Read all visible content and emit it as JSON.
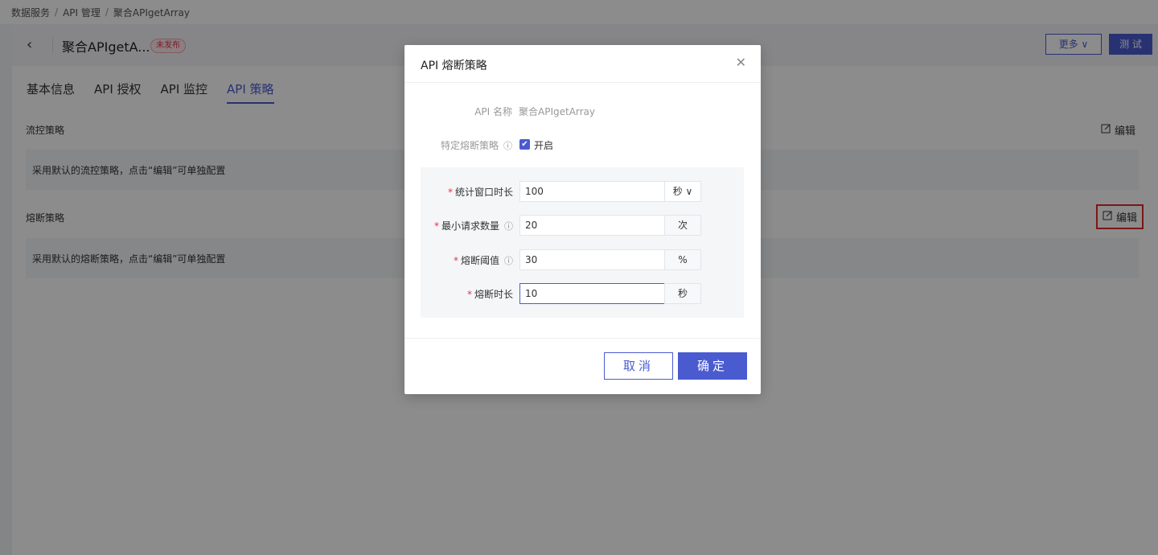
{
  "breadcrumb": {
    "items": [
      "数据服务",
      "API 管理",
      "聚合APIgetArray"
    ],
    "separator": "/"
  },
  "header": {
    "back_icon": "‹",
    "api_title": "聚合APIgetA...",
    "status_badge": "未发布",
    "more_button": "更多 ∨",
    "test_button": "测 试"
  },
  "tabs": [
    {
      "label": "基本信息"
    },
    {
      "label": "API 授权"
    },
    {
      "label": "API 监控"
    },
    {
      "label": "API 策略",
      "active": true
    }
  ],
  "sections": {
    "flow": {
      "title": "流控策略",
      "edit_label": "编辑",
      "description": "采用默认的流控策略，点击“编辑”可单独配置"
    },
    "breaker": {
      "title": "熔断策略",
      "edit_label": "编辑",
      "description": "采用默认的熔断策略，点击“编辑”可单独配置"
    }
  },
  "modal": {
    "title": "API 熔断策略",
    "close_icon": "✕",
    "api_name_label": "API 名称",
    "api_name_value": "聚合APIgetArray",
    "specific_label": "特定熔断策略",
    "specific_checked": true,
    "specific_option": "开启",
    "info_icon": "ⓘ",
    "fields": [
      {
        "label": "统计窗口时长",
        "value": "100",
        "unit": "秒 ∨",
        "info": false
      },
      {
        "label": "最小请求数量",
        "value": "20",
        "unit": "次",
        "info": true
      },
      {
        "label": "熔断阈值",
        "value": "30",
        "unit": "%",
        "info": true
      },
      {
        "label": "熔断时长",
        "value": "10",
        "unit": "秒",
        "info": false
      }
    ],
    "cancel_button": "取消",
    "ok_button": "确定"
  },
  "colors": {
    "accent": "#4a5bd0",
    "required": "#e0364e",
    "highlight": "#e02b2b"
  }
}
